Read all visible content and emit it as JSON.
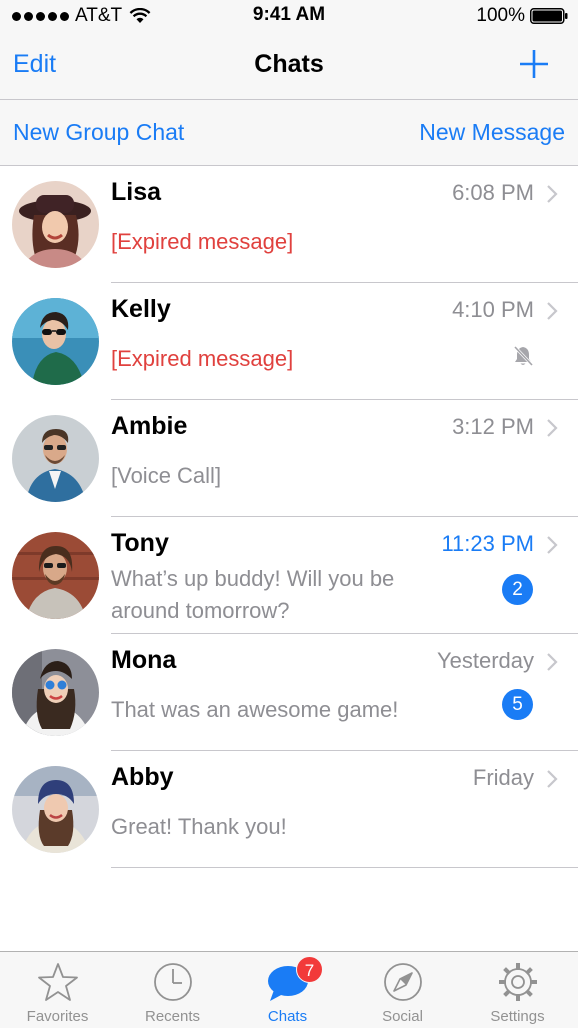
{
  "status_bar": {
    "carrier": "AT&T",
    "time": "9:41 AM",
    "battery": "100%"
  },
  "nav": {
    "edit_label": "Edit",
    "title": "Chats"
  },
  "actions": {
    "new_group_label": "New Group Chat",
    "new_message_label": "New Message"
  },
  "chats": [
    {
      "name": "Lisa",
      "time": "6:08 PM",
      "message": "[Expired message]"
    },
    {
      "name": "Kelly",
      "time": "4:10 PM",
      "message": "[Expired message]",
      "muted": true
    },
    {
      "name": "Ambie",
      "time": "3:12 PM",
      "message": "[Voice Call]"
    },
    {
      "name": "Tony",
      "time": "11:23 PM",
      "message_line1": "What’s up buddy!  Will you be",
      "message_line2": "around tomorrow?",
      "unread": "2"
    },
    {
      "name": "Mona",
      "time": "Yesterday",
      "message": "That was an awesome game!",
      "unread": "5"
    },
    {
      "name": "Abby",
      "time": "Friday",
      "message": "Great! Thank you!"
    }
  ],
  "tabs": [
    {
      "label": "Favorites",
      "icon": "star-icon"
    },
    {
      "label": "Recents",
      "icon": "clock-icon"
    },
    {
      "label": "Chats",
      "icon": "chat-bubble-icon",
      "badge": "7",
      "active": true
    },
    {
      "label": "Social",
      "icon": "compass-icon"
    },
    {
      "label": "Settings",
      "icon": "gear-icon"
    }
  ],
  "colors": {
    "accent": "#1a7cf5",
    "expired": "#e0413e",
    "badge_red": "#f23a3a",
    "secondary_text": "#8e8e93"
  }
}
